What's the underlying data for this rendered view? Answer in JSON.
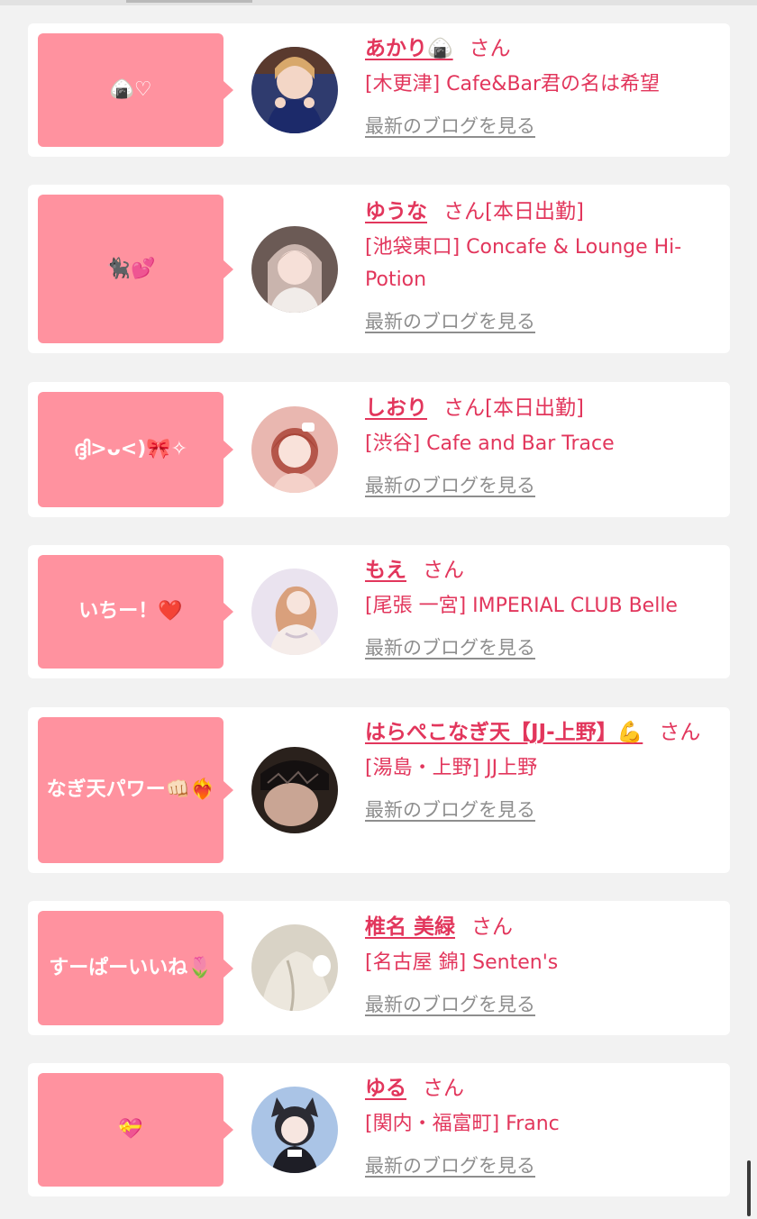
{
  "colors": {
    "accent_pink": "#e2365c",
    "bubble_pink": "#ff929f",
    "link_gray": "#8e8e8e",
    "page_bg": "#f2f2f2"
  },
  "blog_link_label": "最新のブログを見る",
  "entries": [
    {
      "comment": "🍙♡",
      "name": "あかり🍙",
      "suffix": "さん",
      "status": "",
      "shop": "[木更津] Cafe&Bar君の名は希望",
      "blog_label": "最新のブログを見る",
      "avatar_icon": "avatar-akari"
    },
    {
      "comment": "🐈‍⬛💕",
      "name": "ゆうな",
      "suffix": "さん",
      "status": "[本日出勤]",
      "shop": "[池袋東口] Concafe & Lounge Hi-Potion",
      "blog_label": "最新のブログを見る",
      "avatar_icon": "avatar-yuuna"
    },
    {
      "comment": "ദ്ദി>ᴗ<)🎀✧",
      "name": "しおり",
      "suffix": "さん",
      "status": "[本日出勤]",
      "shop": "[渋谷] Cafe and Bar Trace",
      "blog_label": "最新のブログを見る",
      "avatar_icon": "avatar-shiori"
    },
    {
      "comment": "いちー！❤️",
      "name": "もえ",
      "suffix": "さん",
      "status": "",
      "shop": "[尾張 一宮] IMPERIAL CLUB Belle",
      "blog_label": "最新のブログを見る",
      "avatar_icon": "avatar-moe"
    },
    {
      "comment": "なぎ天パワー👊🏻❤️‍🔥",
      "name": "はらぺこなぎ天【JJ-上野】💪",
      "suffix": "さん",
      "status": "",
      "shop": "[湯島・上野] JJ上野",
      "blog_label": "最新のブログを見る",
      "avatar_icon": "avatar-harapeko"
    },
    {
      "comment": "すーぱーいいね🌷",
      "name": "椎名 美緑",
      "suffix": "さん",
      "status": "",
      "shop": "[名古屋 錦] Senten's",
      "blog_label": "最新のブログを見る",
      "avatar_icon": "avatar-shiina"
    },
    {
      "comment": "💝",
      "name": "ゆる",
      "suffix": "さん",
      "status": "",
      "shop": "[関内・福富町] Franc",
      "blog_label": "最新のブログを見る",
      "avatar_icon": "avatar-yuru"
    }
  ]
}
